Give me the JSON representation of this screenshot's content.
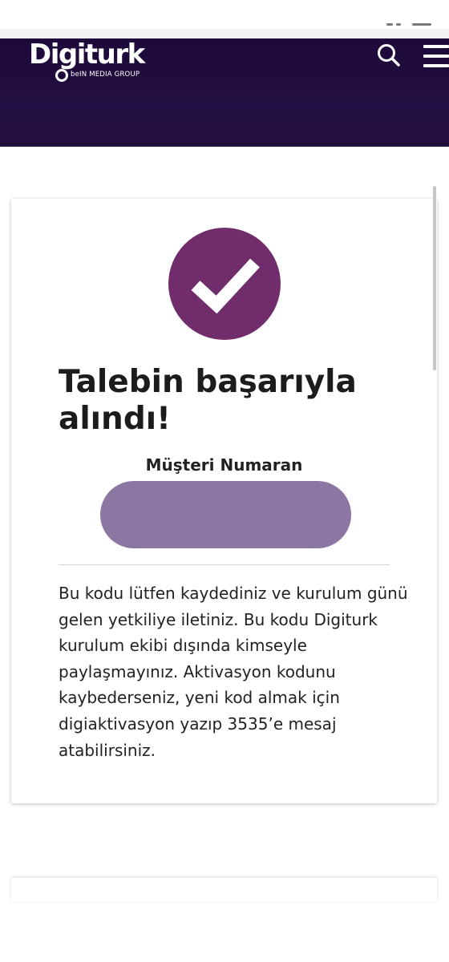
{
  "brand": {
    "name": "Digiturk",
    "subtitle": "beIN MEDIA GROUP"
  },
  "header": {
    "search_icon": "search-icon",
    "menu_icon": "hamburger-menu-icon"
  },
  "success": {
    "icon": "checkmark-icon",
    "title": "Talebin başarıyla alındı!",
    "customer_label": "Müşteri Numaran",
    "customer_value": "",
    "message": "Bu kodu lütfen kaydediniz ve kurulum günü gelen yetkiliye iletiniz. Bu kodu Digiturk kurulum ekibi dışında kimseyle paylaşmayınız. Aktivasyon kodunu kaybederseniz, yeni kod almak için digiaktivasyon yazıp 3535’e mesaj atabilirsiniz."
  },
  "colors": {
    "header_bg": "#1f0b3c",
    "accent_purple": "#712c6b",
    "value_pill": "#8c77a3",
    "text": "#222222"
  }
}
